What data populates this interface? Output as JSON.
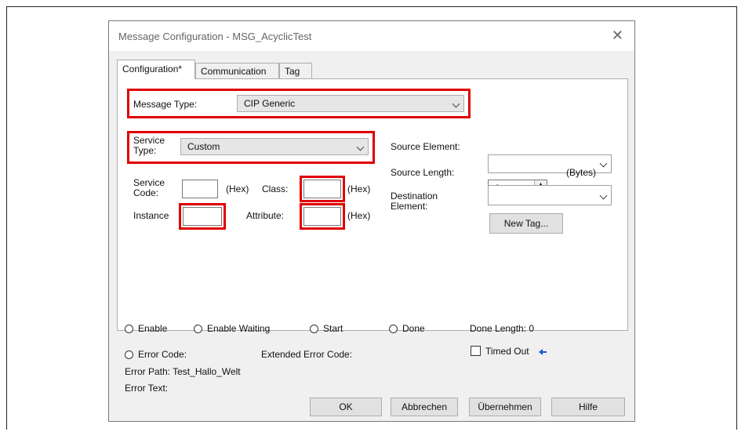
{
  "window": {
    "title": "Message Configuration - MSG_AcyclicTest",
    "close_glyph": "✕"
  },
  "tabs": [
    {
      "label": "Configuration*"
    },
    {
      "label": "Communication"
    },
    {
      "label": "Tag"
    }
  ],
  "config": {
    "message_type": {
      "label": "Message Type:",
      "value": "CIP Generic"
    },
    "service_type": {
      "label": "Service\nType:",
      "value": "Custom"
    },
    "service_code": {
      "label": "Service\nCode:",
      "suffix": "(Hex)",
      "value": ""
    },
    "class": {
      "label": "Class:",
      "suffix": "(Hex)",
      "value": ""
    },
    "instance": {
      "label": "Instance",
      "value": ""
    },
    "attribute": {
      "label": "Attribute:",
      "suffix": "(Hex)",
      "value": ""
    },
    "source_element": {
      "label": "Source Element:",
      "value": ""
    },
    "source_length": {
      "label": "Source Length:",
      "value": "0",
      "unit": "(Bytes)"
    },
    "destination_element": {
      "label": "Destination\nElement:",
      "value": ""
    },
    "new_tag_label": "New Tag..."
  },
  "status": {
    "enable": "Enable",
    "enable_waiting": "Enable Waiting",
    "start": "Start",
    "done": "Done",
    "done_length": "Done Length: 0",
    "error_code": "Error Code:",
    "extended_error_code": "Extended Error Code:",
    "timed_out": "Timed Out",
    "error_path": "Error Path: Test_Hallo_Welt",
    "error_text": "Error Text:"
  },
  "buttons": {
    "ok": "OK",
    "cancel": "Abbrechen",
    "apply": "Übernehmen",
    "help": "Hilfe"
  },
  "colors": {
    "highlight": "#e00000",
    "arrow": "#1a56d6"
  }
}
